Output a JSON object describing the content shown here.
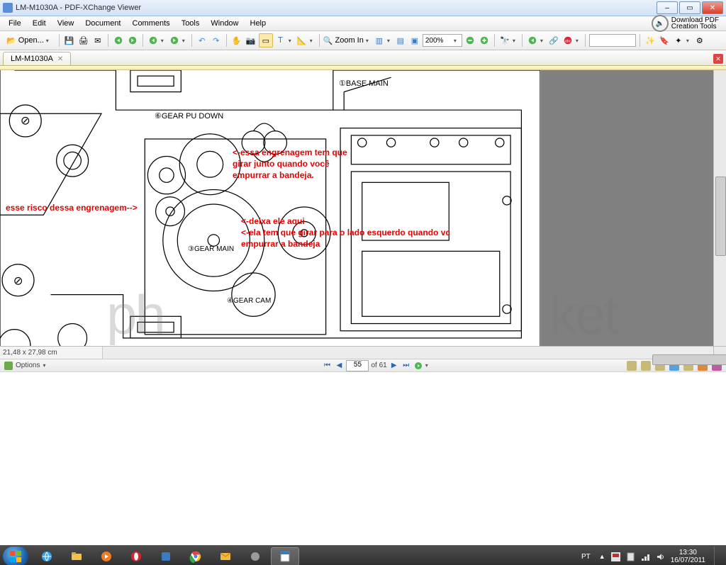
{
  "window": {
    "title": "LM-M1030A - PDF-XChange Viewer"
  },
  "win_buttons": {
    "min": "–",
    "max": "▭",
    "close": "✕"
  },
  "menu": [
    "File",
    "Edit",
    "View",
    "Document",
    "Comments",
    "Tools",
    "Window",
    "Help"
  ],
  "promo": {
    "line1": "Download PDF",
    "line2": "Creation Tools"
  },
  "toolbar": {
    "open": "Open...",
    "zoom_in": "Zoom In",
    "zoom_value": "200%"
  },
  "doc_tab": {
    "name": "LM-M1030A"
  },
  "diagram_labels": {
    "base_main": "①BASE MAIN",
    "gear_pu_down": "⑥GEAR PU DOWN",
    "gear_main": "③GEAR MAIN",
    "gear_cam": "④GEAR CAM"
  },
  "annotations": {
    "left": "esse risco dessa engrenagem-->",
    "top": "<-essa engrenagem tem que\ngirar junto quando você\nempurrar a bandeja.",
    "mid": "<-deixa ele aqui\n<-ela tem que girar para o lado esquerdo quando vc\nempurrar a bandeja"
  },
  "watermark": {
    "left_part": "ph",
    "right_part": "ket"
  },
  "status": {
    "dimensions": "21,48 x 27,98 cm"
  },
  "options": {
    "label": "Options"
  },
  "pagenav": {
    "current": "55",
    "of": "of 61"
  },
  "taskbar": {
    "lang": "PT",
    "time": "13:30",
    "date": "16/07/2011"
  }
}
